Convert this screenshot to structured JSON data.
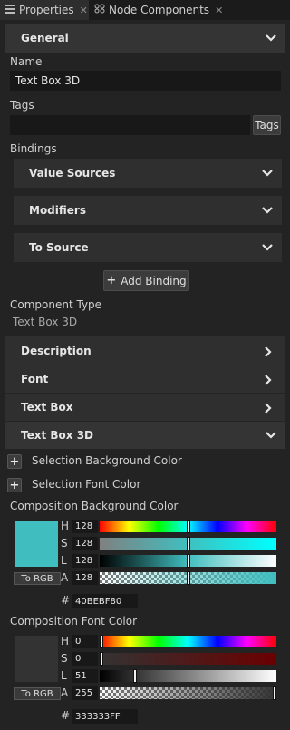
{
  "tabs": [
    {
      "label": "Properties",
      "icon": "properties-icon",
      "active": true
    },
    {
      "label": "Node Components",
      "icon": "node-components-icon",
      "active": false
    }
  ],
  "general": {
    "header": "General",
    "name_label": "Name",
    "name_value": "Text Box 3D",
    "tags_label": "Tags",
    "tags_value": "",
    "tags_button": "Tags",
    "bindings_label": "Bindings",
    "bindings_sections": [
      "Value Sources",
      "Modifiers",
      "To Source"
    ],
    "add_binding": "Add Binding",
    "component_type_label": "Component Type",
    "component_type_value": "Text Box 3D"
  },
  "sections": [
    "Description",
    "Font",
    "Text Box",
    "Text Box 3D"
  ],
  "textbox3d": {
    "add_properties": [
      "Selection Background Color",
      "Selection Font Color"
    ],
    "bg_color": {
      "label": "Composition Background Color",
      "swatch": "#40BEBF",
      "H": "128",
      "S": "128",
      "L": "128",
      "A": "128",
      "hex": "40BEBF80",
      "to_rgb": "To RGB",
      "levels": {
        "H": 0.5,
        "S": 0.5,
        "L": 0.5,
        "A": 0.5
      }
    },
    "font_color": {
      "label": "Composition Font Color",
      "swatch": "#333333",
      "H": "0",
      "S": "0",
      "L": "51",
      "A": "255",
      "hex": "333333FF",
      "to_rgb": "To RGB",
      "levels": {
        "H": 0.0,
        "S": 0.0,
        "L": 0.2,
        "A": 1.0
      }
    }
  },
  "colors": {
    "panel": "#232323",
    "header": "#2f2f2f",
    "field": "#181818"
  }
}
